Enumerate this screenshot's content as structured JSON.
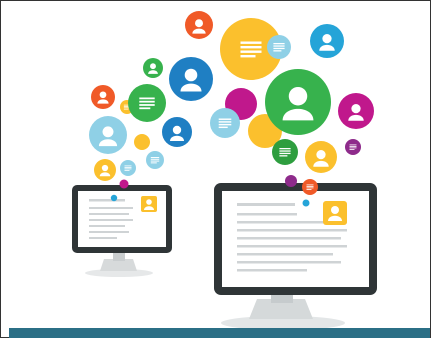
{
  "illustration": {
    "bubble_colors": {
      "blue": "#1f7fc3",
      "cyan": "#25a4d8",
      "light_blue": "#8fd0e6",
      "orange": "#f05a28",
      "yellow": "#fbc02d",
      "green": "#37b24d",
      "dark_green": "#2e9e3f",
      "magenta": "#c0188c",
      "purple": "#8e2b8b",
      "monitor_frame": "#2f3537"
    },
    "icons": [
      "user-icon",
      "document-icon",
      "desktop-monitor-icon"
    ]
  },
  "footer_bar": {
    "color": "#2b6f86"
  }
}
